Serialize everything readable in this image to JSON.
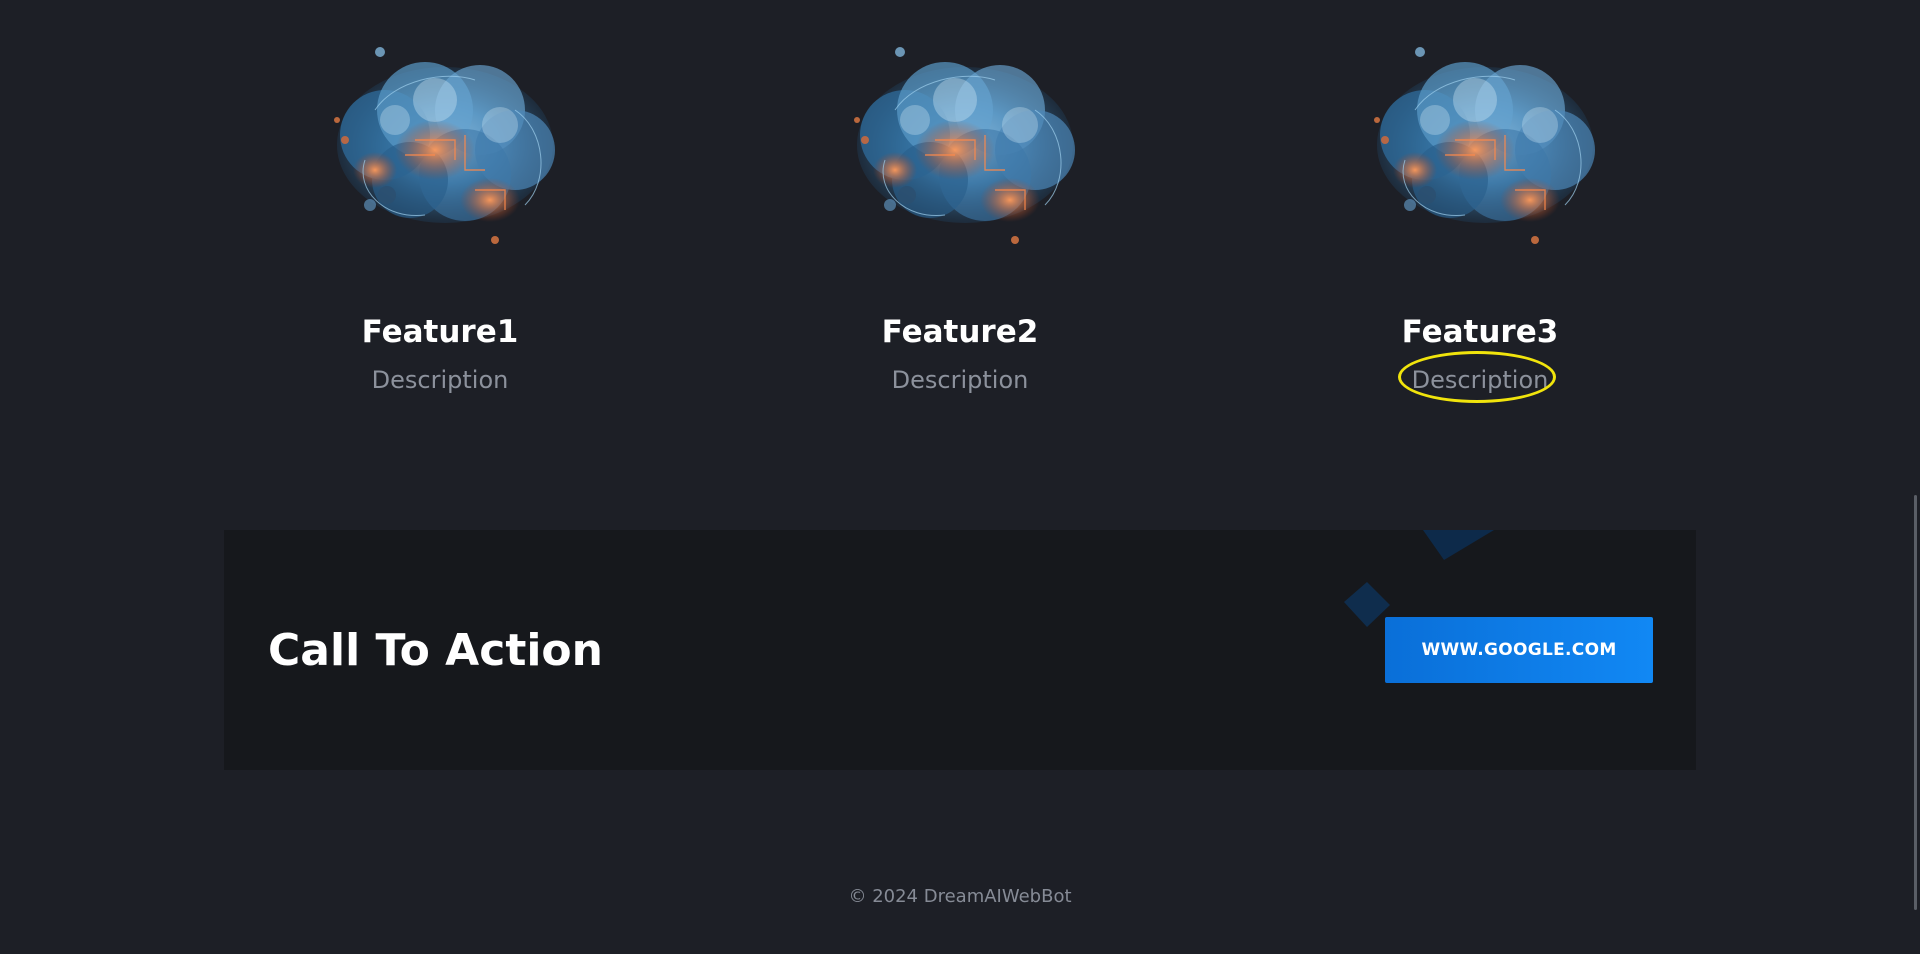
{
  "features": [
    {
      "title": "Feature1",
      "description": "Description",
      "image_icon": "ai-brain-image"
    },
    {
      "title": "Feature2",
      "description": "Description",
      "image_icon": "ai-brain-image"
    },
    {
      "title": "Feature3",
      "description": "Description",
      "image_icon": "ai-brain-image"
    }
  ],
  "cta": {
    "title": "Call To Action",
    "button_label": "WWW.GOOGLE.COM"
  },
  "footer": {
    "text": "© 2024 DreamAIWebBot"
  },
  "colors": {
    "background": "#1d1f26",
    "cta_background": "#16181c",
    "accent": "#0c78e6",
    "highlight": "#f1e40c",
    "muted_text": "#8c919c"
  }
}
